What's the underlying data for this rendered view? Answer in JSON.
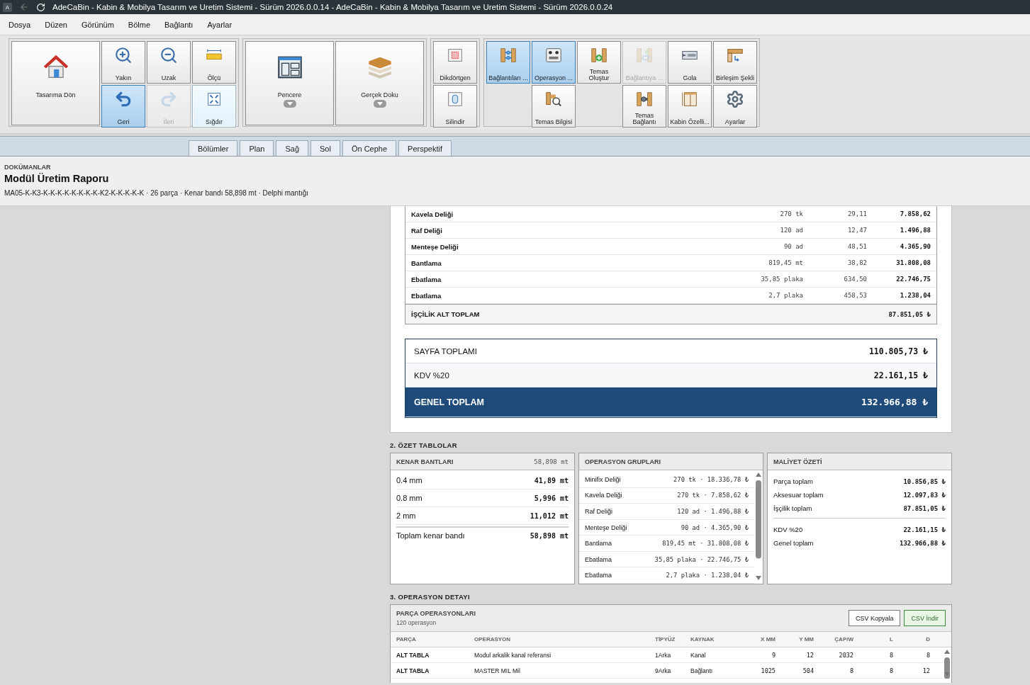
{
  "titlebar": {
    "app_letter": "A",
    "title": "AdeCaBin - Kabin & Mobilya Tasarım ve Uretim Sistemi - Sürüm 2026.0.0.14 - AdeCaBin - Kabin & Mobilya Tasarım ve Uretim Sistemi - Sürüm 2026.0.0.24"
  },
  "menu": [
    "Dosya",
    "Düzen",
    "Görünüm",
    "Bölme",
    "Bağlantı",
    "Ayarlar"
  ],
  "toolbar": {
    "groups": [
      {
        "large": [
          {
            "label": "Tasarıma Dön",
            "selected": false,
            "disabled": false,
            "highlighted": false,
            "dropdown": false
          }
        ],
        "small": [
          {
            "label": "Yakın",
            "selected": false,
            "disabled": false,
            "highlighted": false
          },
          {
            "label": "Uzak",
            "selected": false,
            "disabled": false,
            "highlighted": false
          },
          {
            "label": "Ölçü",
            "selected": false,
            "disabled": false,
            "highlighted": false
          },
          {
            "label": "Geri",
            "selected": true,
            "disabled": false,
            "highlighted": false
          },
          {
            "label": "İleri",
            "selected": false,
            "disabled": true,
            "highlighted": false
          },
          {
            "label": "Sığdır",
            "selected": false,
            "disabled": false,
            "highlighted": true
          }
        ]
      },
      {
        "large": [
          {
            "label": "Pencere",
            "selected": false,
            "disabled": false,
            "highlighted": false,
            "dropdown": true
          },
          {
            "label": "Gerçek Doku",
            "selected": false,
            "disabled": false,
            "highlighted": false,
            "dropdown": true
          }
        ]
      },
      {
        "small": [
          {
            "label": "Dikdörtgen",
            "selected": false,
            "disabled": false,
            "highlighted": false
          },
          {
            "label": "Silindir",
            "selected": false,
            "disabled": false,
            "highlighted": false
          }
        ]
      },
      {
        "small": [
          {
            "label": "Bağlantıları ...",
            "selected": true,
            "disabled": false,
            "highlighted": false
          },
          {
            "label": "Operasyon ...",
            "selected": true,
            "disabled": false,
            "highlighted": false
          },
          {
            "label": "Temas Oluştur",
            "selected": false,
            "disabled": false,
            "highlighted": false
          },
          {
            "label": "Bağlantıya ...",
            "selected": false,
            "disabled": true,
            "highlighted": false
          },
          {
            "label": "Gola",
            "selected": false,
            "disabled": false,
            "highlighted": false
          },
          {
            "label": "Birleşim Şekli",
            "selected": false,
            "disabled": false,
            "highlighted": false
          },
          {
            "label": "Temas Bilgisi",
            "selected": false,
            "disabled": false,
            "highlighted": false
          },
          {
            "label": "Temas Bağlantı",
            "selected": false,
            "disabled": false,
            "highlighted": false
          },
          {
            "label": "Kabin Özelli...",
            "selected": false,
            "disabled": false,
            "highlighted": false
          },
          {
            "label": "Ayarlar",
            "selected": false,
            "disabled": false,
            "highlighted": false
          }
        ]
      }
    ]
  },
  "view_tabs": [
    {
      "label": "Bölümler"
    },
    {
      "label": "Plan"
    },
    {
      "label": "Sağ"
    },
    {
      "label": "Sol"
    },
    {
      "label": "Ön Cephe"
    },
    {
      "label": "Perspektif"
    }
  ],
  "header": {
    "section": "DOKÜMANLAR",
    "title": "Modül Üretim Raporu",
    "subtitle": "MA05-K-K3-K-K-K-K-K-K-K-K-K2-K-K-K-K-K · 26 parça · Kenar bandı 58,898 mt · Delphi mantığı"
  },
  "report": {
    "cost_rows": [
      {
        "name": "Kavela Deliği",
        "qty": "270 tk",
        "unit_price": "29,11",
        "total": "7.858,62"
      },
      {
        "name": "Raf Deliği",
        "qty": "120 ad",
        "unit_price": "12,47",
        "total": "1.496,88"
      },
      {
        "name": "Menteşe Deliği",
        "qty": "90 ad",
        "unit_price": "48,51",
        "total": "4.365,90"
      },
      {
        "name": "Bantlama",
        "qty": "819,45 mt",
        "unit_price": "38,82",
        "total": "31.808,08"
      },
      {
        "name": "Ebatlama",
        "qty": "35,85 plaka",
        "unit_price": "634,50",
        "total": "22.746,75"
      },
      {
        "name": "Ebatlama",
        "qty": "2,7 plaka",
        "unit_price": "458,53",
        "total": "1.238,04"
      }
    ],
    "subtotal": {
      "label": "İŞÇİLİK ALT TOPLAM",
      "value": "87.851,05 ₺"
    },
    "totals": [
      {
        "label": "SAYFA TOPLAMI",
        "value": "110.805,73 ₺",
        "kind": "plain"
      },
      {
        "label": "KDV %20",
        "value": "22.161,15 ₺",
        "kind": "shaded"
      },
      {
        "label": "GENEL TOPLAM",
        "value": "132.966,88 ₺",
        "kind": "grand"
      }
    ]
  },
  "summary": {
    "section_title": "2. ÖZET TABLOLAR",
    "edge_bands": {
      "title": "KENAR BANTLARI",
      "total": "58,898 mt",
      "rows": [
        {
          "label": "0.4 mm",
          "value": "41,89 mt"
        },
        {
          "label": "0.8 mm",
          "value": "5,996 mt"
        },
        {
          "label": "2 mm",
          "value": "11,012 mt"
        }
      ],
      "total_row": {
        "label": "Toplam kenar bandı",
        "value": "58,898 mt"
      }
    },
    "op_groups": {
      "title": "OPERASYON GRUPLARI",
      "rows": [
        {
          "name": "Minifix Deliği",
          "detail": "270 tk · 18.336,78 ₺"
        },
        {
          "name": "Kavela Deliği",
          "detail": "270 tk · 7.858,62 ₺"
        },
        {
          "name": "Raf Deliği",
          "detail": "120 ad · 1.496,88 ₺"
        },
        {
          "name": "Menteşe Deliği",
          "detail": "90 ad · 4.365,90 ₺"
        },
        {
          "name": "Bantlama",
          "detail": "819,45 mt · 31.808,08 ₺"
        },
        {
          "name": "Ebatlama",
          "detail": "35,85 plaka · 22.746,75 ₺"
        },
        {
          "name": "Ebatlama",
          "detail": "2,7 plaka · 1.238,04 ₺"
        }
      ]
    },
    "cost_summary": {
      "title": "MALİYET ÖZETİ",
      "groups": [
        [
          {
            "label": "Parça toplam",
            "value": "10.856,85 ₺"
          },
          {
            "label": "Aksesuar toplam",
            "value": "12.097,83 ₺"
          },
          {
            "label": "İşçilik toplam",
            "value": "87.851,05 ₺"
          }
        ],
        [
          {
            "label": "KDV %20",
            "value": "22.161,15 ₺"
          },
          {
            "label": "Genel toplam",
            "value": "132.966,88 ₺"
          }
        ]
      ]
    }
  },
  "detail": {
    "section_title": "3. OPERASYON DETAYI",
    "title": "PARÇA OPERASYONLARI",
    "count": "120 operasyon",
    "buttons": [
      {
        "label": "CSV Kopyala",
        "kind": "plain"
      },
      {
        "label": "CSV İndir",
        "kind": "primary"
      }
    ],
    "columns": [
      "PARÇA",
      "OPERASYON",
      "TİPYÜZ",
      "KAYNAK",
      "X MM",
      "Y MM",
      "ÇAP/W",
      "L",
      "D"
    ],
    "rows": [
      [
        "ALT TABLA",
        "Modul arkalik kanal referansi",
        "1Arka",
        "Kanal",
        "9",
        "12",
        "2032",
        "8",
        "8"
      ],
      [
        "ALT TABLA",
        "MASTER MIL Mil",
        "9Arka",
        "Bağlantı",
        "1025",
        "504",
        "8",
        "8",
        "12"
      ]
    ]
  }
}
